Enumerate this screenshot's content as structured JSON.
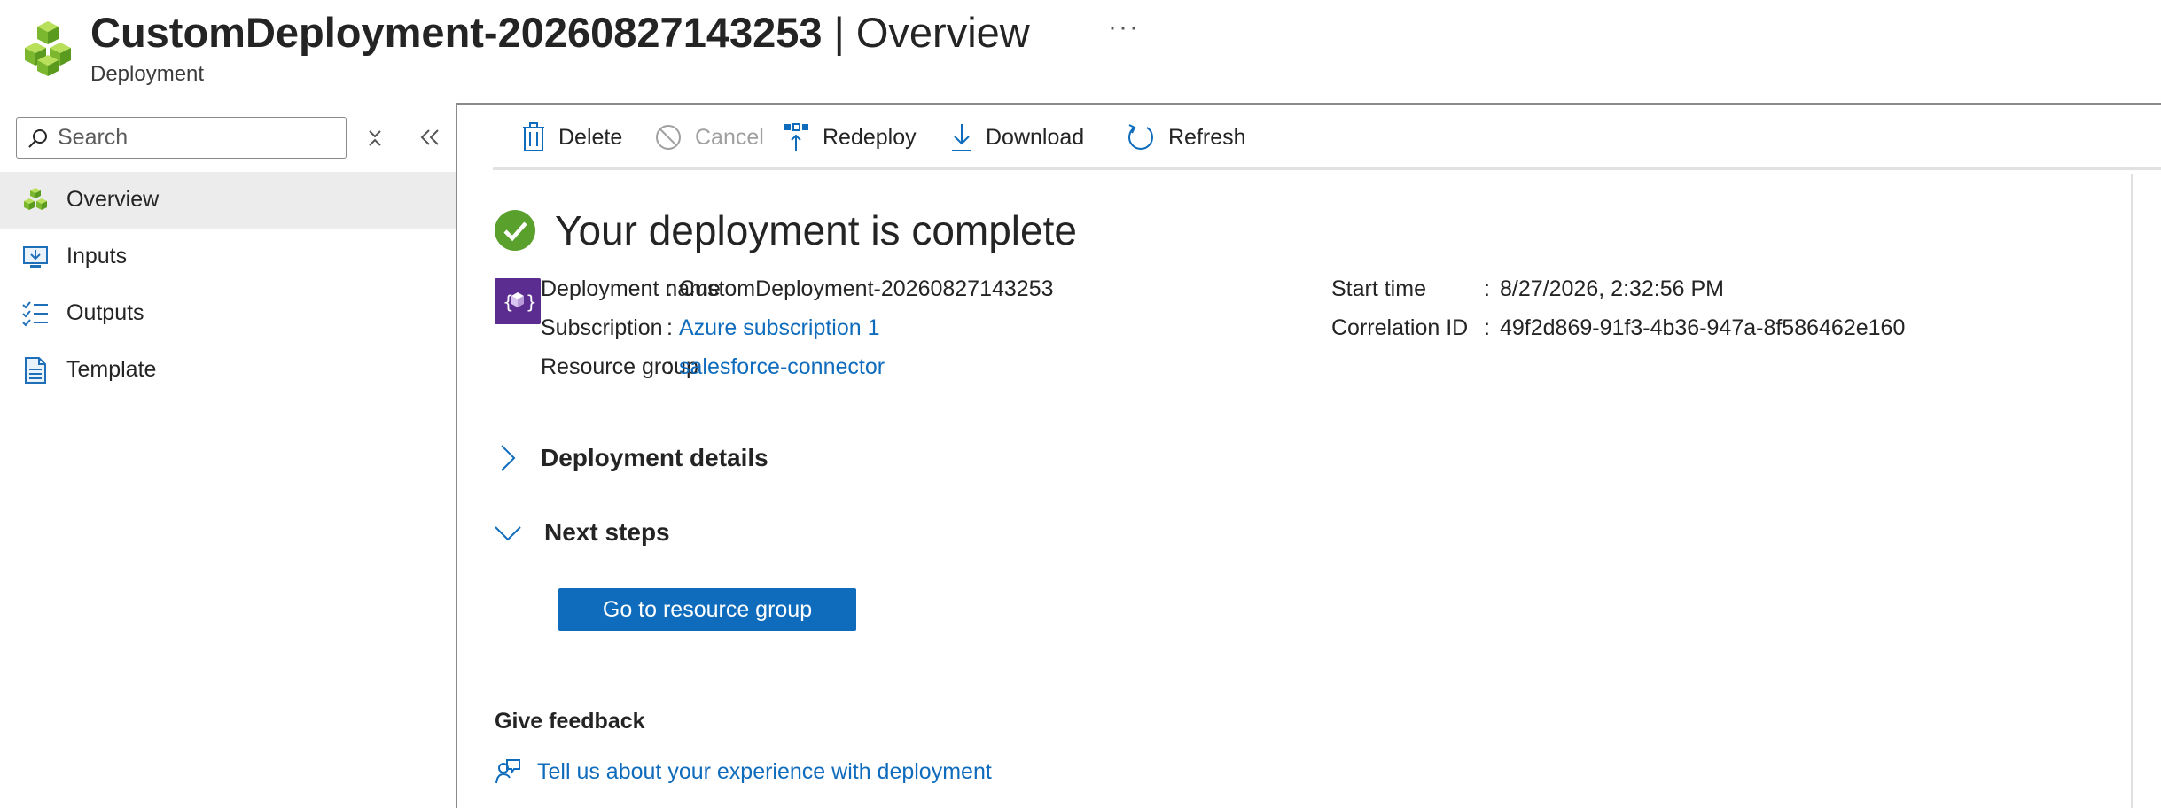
{
  "header": {
    "title_name": "CustomDeployment-20260827143253",
    "title_separator": " | ",
    "title_section": "Overview",
    "subtitle": "Deployment",
    "more_label": "···"
  },
  "sidebar": {
    "search": {
      "placeholder": "Search",
      "value": ""
    },
    "items": [
      {
        "label": "Overview",
        "icon": "cubes-icon",
        "active": true
      },
      {
        "label": "Inputs",
        "icon": "inputs-icon"
      },
      {
        "label": "Outputs",
        "icon": "outputs-icon"
      },
      {
        "label": "Template",
        "icon": "template-icon"
      }
    ]
  },
  "toolbar": {
    "delete": "Delete",
    "cancel": "Cancel",
    "redeploy": "Redeploy",
    "download": "Download",
    "refresh": "Refresh"
  },
  "status": {
    "title": "Your deployment is complete"
  },
  "details": {
    "deployment_name_label": "Deployment name",
    "deployment_name": "CustomDeployment-20260827143253",
    "subscription_label": "Subscription",
    "subscription": "Azure subscription 1",
    "resource_group_label": "Resource group",
    "resource_group": "salesforce-connector",
    "start_time_label": "Start time",
    "start_time": "8/27/2026, 2:32:56 PM",
    "correlation_id_label": "Correlation ID",
    "correlation_id": "49f2d869-91f3-4b36-947a-8f586462e160",
    "colon": ":"
  },
  "sections": {
    "deployment_details": "Deployment details",
    "next_steps": "Next steps"
  },
  "actions": {
    "go_to_resource_group": "Go to resource group"
  },
  "feedback": {
    "title": "Give feedback",
    "link": "Tell us about your experience with deployment"
  },
  "colors": {
    "accent": "#0f6cbd",
    "success": "#5aa02c",
    "deploy_icon_bg": "#5c2d91",
    "active_nav_bg": "#ececec"
  }
}
